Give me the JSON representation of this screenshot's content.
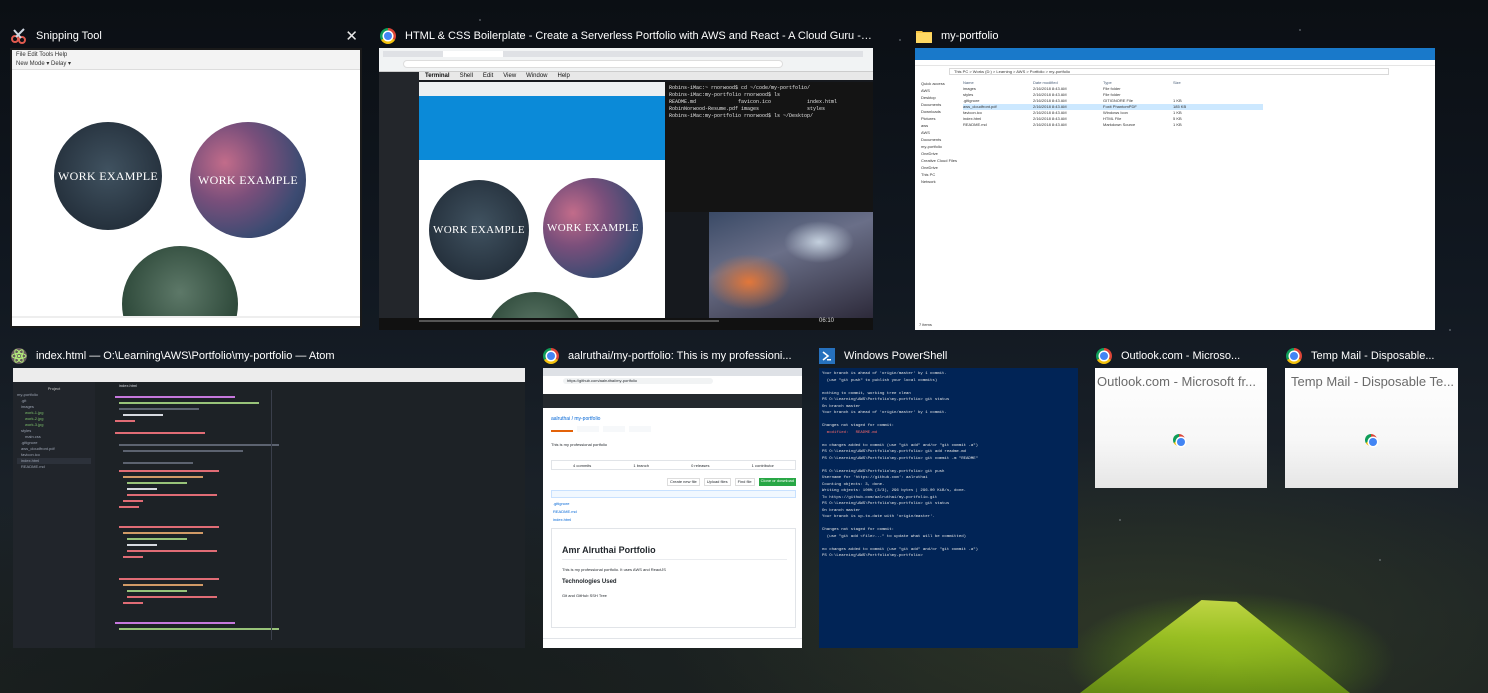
{
  "windows": [
    {
      "id": "snipping",
      "title": "Snipping Tool",
      "close_glyph": "✕",
      "menu": "File  Edit  Tools  Help",
      "toolbar": "New  Mode ▾  Delay ▾",
      "circle_labels": [
        "WORK EXAMPLE",
        "WORK EXAMPLE"
      ]
    },
    {
      "id": "chrome-acg",
      "title": "HTML & CSS Boilerplate - Create a Serverless Portfolio with AWS and React - A Cloud Guru - Googl...",
      "menu_items": [
        "Terminal",
        "Shell",
        "Edit",
        "View",
        "Window",
        "Help"
      ],
      "terminal_lines": [
        "Robins-iMac:~ rnorwood$ cd ~/code/my-portfolio/",
        "Robins-iMac:my-portfolio rnorwood$ ls",
        "README.md              favicon.ico            index.html",
        "RobinNorwood-Resume.pdf images                styles",
        "Robins-iMac:my-portfolio rnorwood$ ls ~/Desktop/"
      ],
      "circle_labels": [
        "WORK EXAMPLE",
        "WORK EXAMPLE"
      ],
      "video_time": "06:10"
    },
    {
      "id": "explorer",
      "title": "my-portfolio",
      "breadcrumb": "This PC  >  Works (D:)  >  Learning  >  AWS  >  Portfolio  >  my-portfolio",
      "columns": [
        "Name",
        "Date modified",
        "Type",
        "Size"
      ],
      "files": [
        {
          "name": "images",
          "date": "2/16/2018 8:43 AM",
          "type": "File folder",
          "size": ""
        },
        {
          "name": "styles",
          "date": "2/16/2018 8:43 AM",
          "type": "File folder",
          "size": ""
        },
        {
          "name": ".gitignore",
          "date": "2/16/2018 8:43 AM",
          "type": "GITIGNORE File",
          "size": "1 KB"
        },
        {
          "name": "aws_cloudfront.pdf",
          "date": "2/16/2018 8:43 AM",
          "type": "Foxit PhantomPDF",
          "size": "185 KB"
        },
        {
          "name": "favicon.ico",
          "date": "2/16/2018 8:43 AM",
          "type": "Windows Icon",
          "size": "1 KB"
        },
        {
          "name": "index.html",
          "date": "2/16/2018 8:43 AM",
          "type": "HTML File",
          "size": "5 KB"
        },
        {
          "name": "README.md",
          "date": "2/16/2018 8:43 AM",
          "type": "Markdown Source",
          "size": "1 KB"
        }
      ],
      "sidebar": [
        "Quick access",
        "AWS",
        "Desktop",
        "Documents",
        "Downloads",
        "Pictures",
        "aws",
        "AWS",
        "Documents",
        "my-portfolio",
        "OneDrive",
        "Creative Cloud Files",
        "OneDrive",
        "This PC",
        "Network"
      ],
      "status": "7 items"
    },
    {
      "id": "atom",
      "title": "index.html — O:\\Learning\\AWS\\Portfolio\\my-portfolio — Atom",
      "tabs": [
        "Project",
        "index.html"
      ],
      "tree": [
        "my-portfolio",
        ".git",
        "images",
        "work-1.jpg",
        "work-2.jpg",
        "work-3.jpg",
        "styles",
        "main.css",
        ".gitignore",
        "aws_cloudfront.pdf",
        "favicon.ico",
        "index.html",
        "README.md"
      ]
    },
    {
      "id": "chrome-github",
      "title": "aalruthai/my-portfolio: This is my professioni...",
      "url": "https://github.com/aalruthai/my-portfolio",
      "repo": "aalruthai / my-portfolio",
      "description": "This is my professional portfolio",
      "stats": [
        "4 commits",
        "1 branch",
        "0 releases",
        "1 contributor"
      ],
      "files": [
        ".gitignore",
        "README.md",
        "index.html"
      ],
      "readme_title": "Amr Alruthai Portfolio",
      "readme_text": "This is my professional portfolio. It uses AWS and ReactJS",
      "readme_h2": "Technologies Used",
      "readme_list": "Git and GitHub SSH Tree",
      "buttons": [
        "Create new file",
        "Upload files",
        "Find file",
        "Clone or download"
      ]
    },
    {
      "id": "powershell",
      "title": "Windows PowerShell",
      "lines": [
        "Your branch is ahead of 'origin/master' by 1 commit.",
        "  (use \"git push\" to publish your local commits)",
        "",
        "nothing to commit, working tree clean",
        "PS O:\\Learning\\AWS\\Portfolio\\my-portfolio> git status",
        "On branch master",
        "Your branch is ahead of 'origin/master' by 1 commit.",
        "",
        "Changes not staged for commit:",
        "  modified:   README.md",
        "",
        "no changes added to commit (use \"git add\" and/or \"git commit -a\")",
        "PS O:\\Learning\\AWS\\Portfolio\\my-portfolio> git add readme.md",
        "PS O:\\Learning\\AWS\\Portfolio\\my-portfolio> git commit -m \"README\"",
        "",
        "PS O:\\Learning\\AWS\\Portfolio\\my-portfolio> git push",
        "Username for 'https://github.com': aalruthai",
        "Counting objects: 3, done.",
        "Writing objects: 100% (3/3), 296 bytes | 296.00 KiB/s, done.",
        "To https://github.com/aalruthai/my-portfolio.git",
        "PS O:\\Learning\\AWS\\Portfolio\\my-portfolio> git status",
        "On branch master",
        "Your branch is up-to-date with 'origin/master'.",
        "",
        "Changes not staged for commit:",
        "  (use \"git add <file>...\" to update what will be committed)",
        "",
        "no changes added to commit (use \"git add\" and/or \"git commit -a\")",
        "PS O:\\Learning\\AWS\\Portfolio\\my-portfolio>"
      ]
    },
    {
      "id": "outlook",
      "title": "Outlook.com - Microso...",
      "thumb_title": "Outlook.com - Microsoft fr..."
    },
    {
      "id": "tempmail",
      "title": "Temp Mail - Disposable...",
      "thumb_title": "Temp Mail - Disposable Te..."
    }
  ],
  "colors": {
    "chrome_blue": "#4285f4",
    "github_green": "#28a745",
    "powershell_bg": "#012456",
    "atom_bg": "#1d2226",
    "terminal_bg": "#141414"
  }
}
